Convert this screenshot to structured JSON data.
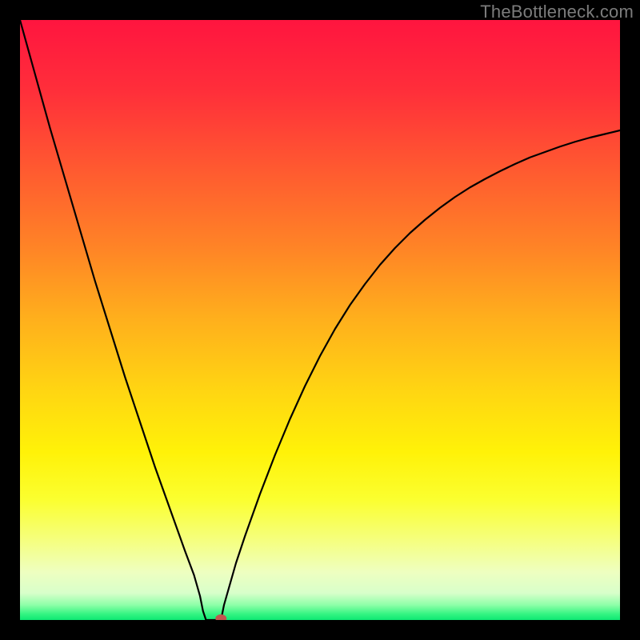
{
  "watermark": "TheBottleneck.com",
  "chart_data": {
    "type": "line",
    "title": "",
    "xlabel": "",
    "ylabel": "",
    "xlim": [
      0,
      1
    ],
    "ylim": [
      0,
      100
    ],
    "series": [
      {
        "name": "left-branch",
        "x": [
          0.0,
          0.025,
          0.05,
          0.075,
          0.1,
          0.125,
          0.15,
          0.175,
          0.2,
          0.225,
          0.25,
          0.275,
          0.29,
          0.3,
          0.305,
          0.31
        ],
        "values": [
          100.0,
          91.0,
          82.0,
          73.5,
          65.0,
          56.5,
          48.5,
          40.5,
          33.0,
          25.5,
          18.5,
          11.5,
          7.5,
          4.0,
          1.5,
          0.0
        ]
      },
      {
        "name": "flat-segment",
        "x": [
          0.31,
          0.335
        ],
        "values": [
          0.0,
          0.0
        ]
      },
      {
        "name": "right-branch",
        "x": [
          0.335,
          0.34,
          0.35,
          0.36,
          0.375,
          0.4,
          0.425,
          0.45,
          0.475,
          0.5,
          0.525,
          0.55,
          0.575,
          0.6,
          0.625,
          0.65,
          0.675,
          0.7,
          0.725,
          0.75,
          0.775,
          0.8,
          0.825,
          0.85,
          0.875,
          0.9,
          0.925,
          0.95,
          0.975,
          1.0
        ],
        "values": [
          0.0,
          2.5,
          6.0,
          9.5,
          14.0,
          21.0,
          27.5,
          33.5,
          39.0,
          44.0,
          48.5,
          52.5,
          56.0,
          59.2,
          62.0,
          64.5,
          66.7,
          68.7,
          70.5,
          72.1,
          73.5,
          74.8,
          76.0,
          77.1,
          78.0,
          78.9,
          79.7,
          80.4,
          81.0,
          81.6
        ]
      }
    ],
    "marker": {
      "x": 0.335,
      "y": 0.0,
      "color": "#c1564f"
    },
    "background_gradient": {
      "stops": [
        {
          "offset": 0.0,
          "color": "#ff153f"
        },
        {
          "offset": 0.12,
          "color": "#ff2f3a"
        },
        {
          "offset": 0.25,
          "color": "#ff5a30"
        },
        {
          "offset": 0.38,
          "color": "#ff8426"
        },
        {
          "offset": 0.5,
          "color": "#ffb01c"
        },
        {
          "offset": 0.62,
          "color": "#ffd612"
        },
        {
          "offset": 0.72,
          "color": "#fff208"
        },
        {
          "offset": 0.8,
          "color": "#fbff30"
        },
        {
          "offset": 0.87,
          "color": "#f5ff82"
        },
        {
          "offset": 0.92,
          "color": "#eeffc0"
        },
        {
          "offset": 0.955,
          "color": "#d8ffca"
        },
        {
          "offset": 0.975,
          "color": "#8dffa8"
        },
        {
          "offset": 0.99,
          "color": "#34f482"
        },
        {
          "offset": 1.0,
          "color": "#0ee873"
        }
      ]
    }
  }
}
